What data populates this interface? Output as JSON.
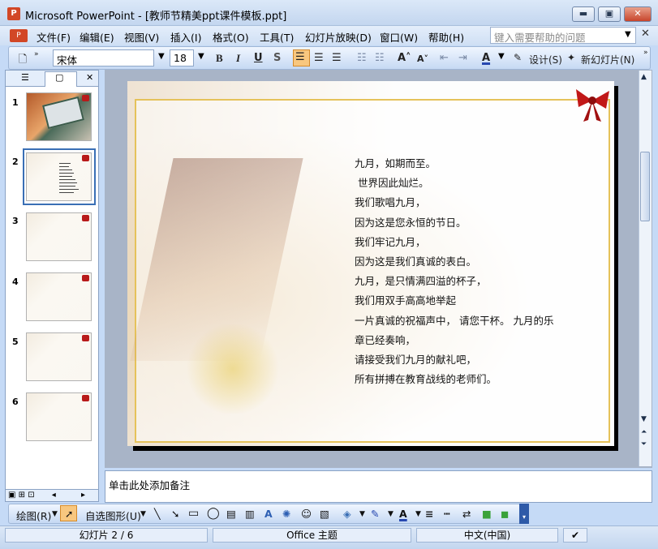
{
  "window": {
    "title": "Microsoft PowerPoint - [教师节精美ppt课件模板.ppt]",
    "app_icon": "P",
    "min": "▬",
    "max": "▣",
    "close": "✕"
  },
  "menu": [
    "文件(F)",
    "编辑(E)",
    "视图(V)",
    "插入(I)",
    "格式(O)",
    "工具(T)",
    "幻灯片放映(D)",
    "窗口(W)",
    "帮助(H)"
  ],
  "help": {
    "placeholder": "键入需要帮助的问题"
  },
  "toolbar": {
    "font": "宋体",
    "size": "18",
    "bold": "B",
    "italic": "I",
    "underline": "U",
    "shadow": "S",
    "design_label": "设计(S)",
    "new_slide_label": "新幻灯片(N)"
  },
  "panel": {
    "tab_outline_icon": "outline-icon",
    "tab_slides_icon": "slides-icon",
    "close": "✕"
  },
  "thumbnails": [
    {
      "num": "1"
    },
    {
      "num": "2"
    },
    {
      "num": "3"
    },
    {
      "num": "4"
    },
    {
      "num": "5"
    },
    {
      "num": "6"
    }
  ],
  "slide": {
    "lines": [
      "九月，如期而至。",
      " 世界因此灿烂。",
      "我们歌唱九月，",
      "因为这是您永恒的节日。",
      "我们牢记九月，",
      "因为这是我们真诚的表白。",
      "九月，是只情满四溢的杯子，",
      "我们用双手高高地举起",
      "一片真诚的祝福声中， 请您干杯。 九月的乐",
      "章已经奏响，",
      "请接受我们九月的献礼吧，",
      "所有拼搏在教育战线的老师们。"
    ]
  },
  "notes": {
    "placeholder": "单击此处添加备注"
  },
  "drawbar": {
    "draw": "绘图(R)",
    "autoshapes": "自选图形(U)"
  },
  "status": {
    "slide": "幻灯片 2 / 6",
    "theme": "Office 主题",
    "lang": "中文(中国)"
  }
}
